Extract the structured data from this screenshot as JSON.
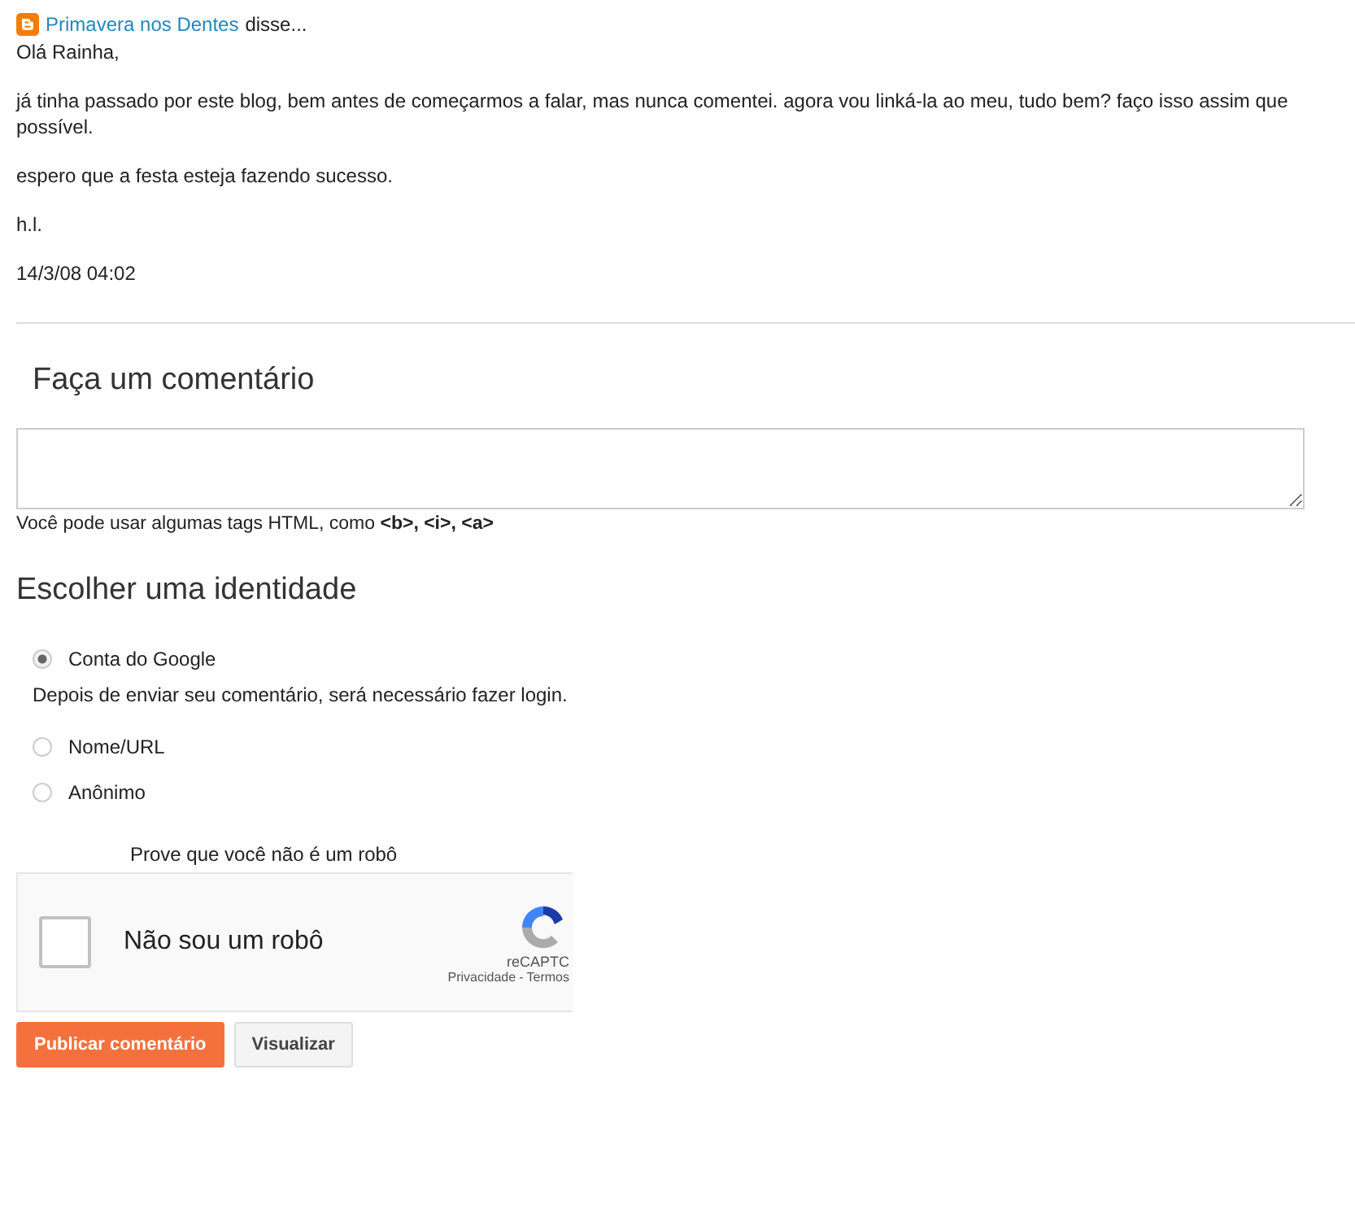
{
  "comment": {
    "author": "Primavera nos Dentes",
    "said": "disse...",
    "paragraphs": [
      "Olá Rainha,",
      "já tinha passado por este blog, bem antes de começarmos a falar, mas nunca comentei. agora vou linká-la ao meu, tudo bem? faço isso assim que possível.",
      "espero que a festa esteja fazendo sucesso.",
      "h.l."
    ],
    "timestamp": "14/3/08 04:02"
  },
  "form": {
    "title": "Faça um comentário",
    "hint": "Você pode usar algumas tags HTML, como **<b>, <i>, <a>**"
  },
  "identity": {
    "title": "Escolher uma identidade",
    "options": [
      {
        "label": "Conta do Google",
        "selected": true,
        "note": "Depois de enviar seu comentário, será necessário fazer login."
      },
      {
        "label": "Nome/URL",
        "selected": false
      },
      {
        "label": "Anônimo",
        "selected": false
      }
    ]
  },
  "captcha": {
    "prompt": "Prove que você não é um robô",
    "label": "Não sou um robô",
    "checked": false,
    "brand": "reCAPTC",
    "privacy": "Privacidade",
    "separator": "-",
    "terms": "Termos"
  },
  "buttons": [
    {
      "label": "Publicar comentário",
      "kind": "primary"
    },
    {
      "label": "Visualizar",
      "kind": "secondary"
    }
  ]
}
